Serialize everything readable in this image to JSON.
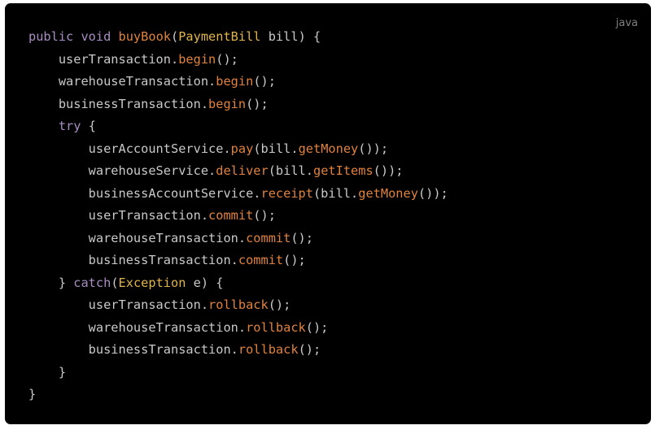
{
  "code_block": {
    "language": "java",
    "lines": [
      [
        {
          "t": "public void ",
          "c": "kw"
        },
        {
          "t": "buyBook",
          "c": "fn"
        },
        {
          "t": "(",
          "c": "id"
        },
        {
          "t": "PaymentBill",
          "c": "ty"
        },
        {
          "t": " bill) {",
          "c": "id"
        }
      ],
      [
        {
          "t": "    userTransaction.",
          "c": "id"
        },
        {
          "t": "begin",
          "c": "fn"
        },
        {
          "t": "();",
          "c": "id"
        }
      ],
      [
        {
          "t": "    warehouseTransaction.",
          "c": "id"
        },
        {
          "t": "begin",
          "c": "fn"
        },
        {
          "t": "();",
          "c": "id"
        }
      ],
      [
        {
          "t": "    businessTransaction.",
          "c": "id"
        },
        {
          "t": "begin",
          "c": "fn"
        },
        {
          "t": "();",
          "c": "id"
        }
      ],
      [
        {
          "t": "    ",
          "c": "id"
        },
        {
          "t": "try",
          "c": "kw"
        },
        {
          "t": " {",
          "c": "id"
        }
      ],
      [
        {
          "t": "        userAccountService.",
          "c": "id"
        },
        {
          "t": "pay",
          "c": "fn"
        },
        {
          "t": "(bill.",
          "c": "id"
        },
        {
          "t": "getMoney",
          "c": "fn"
        },
        {
          "t": "());",
          "c": "id"
        }
      ],
      [
        {
          "t": "        warehouseService.",
          "c": "id"
        },
        {
          "t": "deliver",
          "c": "fn"
        },
        {
          "t": "(bill.",
          "c": "id"
        },
        {
          "t": "getItems",
          "c": "fn"
        },
        {
          "t": "());",
          "c": "id"
        }
      ],
      [
        {
          "t": "        businessAccountService.",
          "c": "id"
        },
        {
          "t": "receipt",
          "c": "fn"
        },
        {
          "t": "(bill.",
          "c": "id"
        },
        {
          "t": "getMoney",
          "c": "fn"
        },
        {
          "t": "());",
          "c": "id"
        }
      ],
      [
        {
          "t": "        userTransaction.",
          "c": "id"
        },
        {
          "t": "commit",
          "c": "fn"
        },
        {
          "t": "();",
          "c": "id"
        }
      ],
      [
        {
          "t": "        warehouseTransaction.",
          "c": "id"
        },
        {
          "t": "commit",
          "c": "fn"
        },
        {
          "t": "();",
          "c": "id"
        }
      ],
      [
        {
          "t": "        businessTransaction.",
          "c": "id"
        },
        {
          "t": "commit",
          "c": "fn"
        },
        {
          "t": "();",
          "c": "id"
        }
      ],
      [
        {
          "t": "    } ",
          "c": "id"
        },
        {
          "t": "catch",
          "c": "kw"
        },
        {
          "t": "(",
          "c": "id"
        },
        {
          "t": "Exception",
          "c": "ty"
        },
        {
          "t": " e) {",
          "c": "id"
        }
      ],
      [
        {
          "t": "        userTransaction.",
          "c": "id"
        },
        {
          "t": "rollback",
          "c": "fn"
        },
        {
          "t": "();",
          "c": "id"
        }
      ],
      [
        {
          "t": "        warehouseTransaction.",
          "c": "id"
        },
        {
          "t": "rollback",
          "c": "fn"
        },
        {
          "t": "();",
          "c": "id"
        }
      ],
      [
        {
          "t": "        businessTransaction.",
          "c": "id"
        },
        {
          "t": "rollback",
          "c": "fn"
        },
        {
          "t": "();",
          "c": "id"
        }
      ],
      [
        {
          "t": "    }",
          "c": "id"
        }
      ],
      [
        {
          "t": "}",
          "c": "id"
        }
      ]
    ]
  },
  "colors": {
    "background": "#000000",
    "keyword": "#a88dc2",
    "function": "#e0823d",
    "type": "#e1b44a",
    "identifier": "#c9c9c9",
    "label": "#7f7f7f"
  }
}
